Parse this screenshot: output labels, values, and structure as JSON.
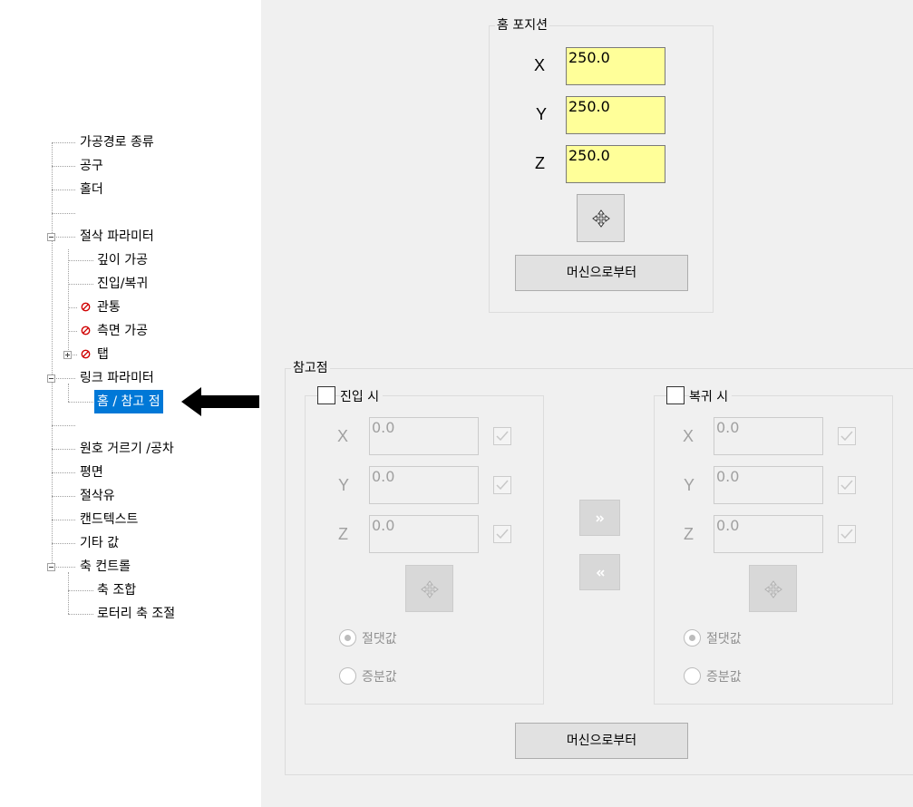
{
  "tree": {
    "items": [
      {
        "label": "가공경로 종류"
      },
      {
        "label": "공구"
      },
      {
        "label": "홀더"
      },
      {
        "label": ""
      },
      {
        "label": "절삭 파라미터"
      },
      {
        "label": "깊이 가공"
      },
      {
        "label": "진입/복귀"
      },
      {
        "label": "관통"
      },
      {
        "label": "측면 가공"
      },
      {
        "label": "탭"
      },
      {
        "label": "링크 파라미터"
      },
      {
        "label": "홈 / 참고 점"
      },
      {
        "label": ""
      },
      {
        "label": "원호 거르기 /공차"
      },
      {
        "label": "평면"
      },
      {
        "label": "절삭유"
      },
      {
        "label": "캔드텍스트"
      },
      {
        "label": "기타 값"
      },
      {
        "label": "축 컨트롤"
      },
      {
        "label": "축 조합"
      },
      {
        "label": "로터리 축 조절"
      }
    ],
    "selected": "홈 / 참고 점",
    "icons": {
      "disabled": "ban-icon",
      "pointer": "arrow-left-icon",
      "expand": "tree-expander"
    },
    "colors": {
      "selection": "#0078d7",
      "ban": "#d00000"
    }
  },
  "home": {
    "title": "홈 포지션",
    "x_label": "X",
    "x_value": "250.0",
    "y_label": "Y",
    "y_value": "250.0",
    "z_label": "Z",
    "z_value": "250.0",
    "select_icon": "move-icon",
    "from_machine": "머신으로부터",
    "input_color": "#ffff99"
  },
  "reference": {
    "title": "참고점",
    "entry": {
      "label": "진입 시",
      "x_label": "X",
      "x_value": "0.0",
      "y_label": "Y",
      "y_value": "0.0",
      "z_label": "Z",
      "z_value": "0.0",
      "absolute": "절댓값",
      "incremental": "증분값"
    },
    "retract": {
      "label": "복귀 시",
      "x_label": "X",
      "x_value": "0.0",
      "y_label": "Y",
      "y_value": "0.0",
      "z_label": "Z",
      "z_value": "0.0",
      "absolute": "절댓값",
      "incremental": "증분값"
    },
    "copy_right_icon": "double-chevron-right-icon",
    "copy_left_icon": "double-chevron-left-icon",
    "from_machine": "머신으로부터"
  }
}
